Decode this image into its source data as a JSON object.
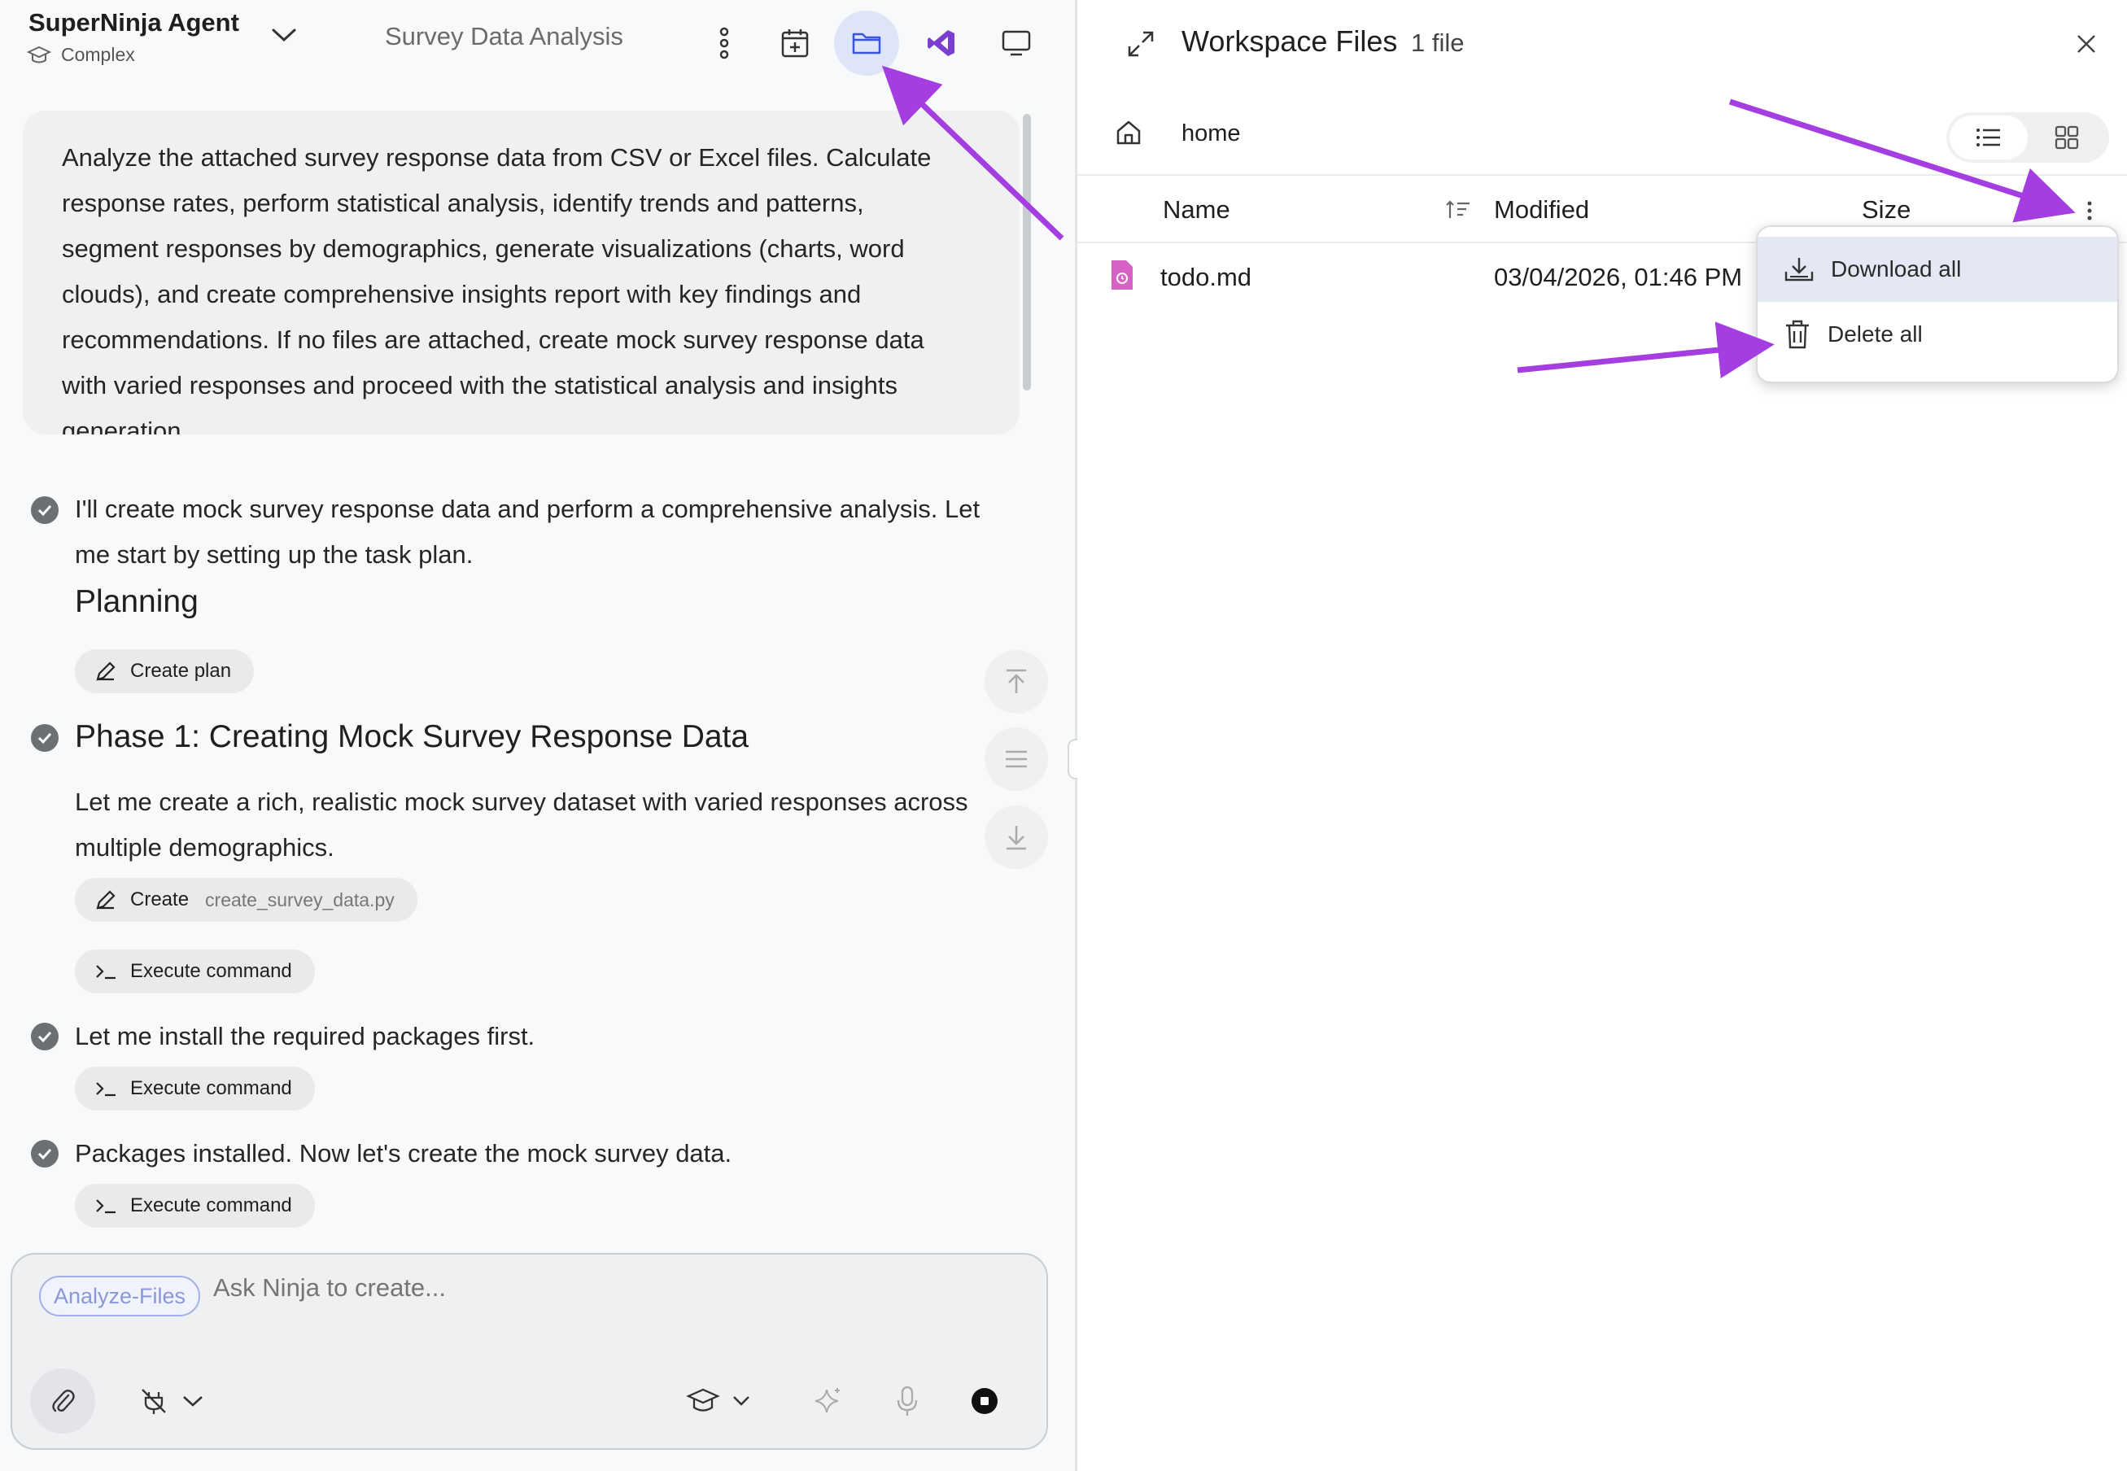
{
  "header": {
    "agent_name": "SuperNinja Agent",
    "agent_mode": "Complex",
    "task_title": "Survey Data Analysis"
  },
  "toolbar": {
    "icons": [
      "more-vertical-icon",
      "calendar-add-icon",
      "folder-icon",
      "vscode-icon",
      "monitor-icon"
    ],
    "active": "folder-icon",
    "active_color": "#dde5f6"
  },
  "prompt": {
    "lines": [
      "Analyze the attached survey response data from CSV or Excel files. Calculate",
      "response rates, perform statistical analysis, identify trends and patterns,",
      "segment responses by demographics, generate visualizations (charts, word",
      "clouds), and create comprehensive insights report with key findings and",
      "recommendations. If no files are attached, create mock survey response data",
      "with varied responses and proceed with the statistical analysis and insights",
      "generation."
    ]
  },
  "steps": {
    "s1_line1": "I'll create mock survey response data and perform a comprehensive analysis. Let",
    "s1_line2": "me start by setting up the task plan.",
    "planning_title": "Planning",
    "create_plan_label": "Create plan",
    "phase1_title": "Phase 1: Creating Mock Survey Response Data",
    "phase1_line1": "Let me create a rich, realistic mock survey dataset with varied responses across",
    "phase1_line2": "multiple demographics.",
    "create_label": "Create",
    "create_file": "create_survey_data.py",
    "execute_label": "Execute command",
    "s3_text": "Let me install the required packages first.",
    "s4_text": "Packages installed. Now let's create the mock survey data."
  },
  "composer": {
    "tag": "Analyze-Files",
    "placeholder": "Ask Ninja to create..."
  },
  "panel": {
    "title": "Workspace Files",
    "count": "1 file",
    "breadcrumb": "home",
    "columns": {
      "name": "Name",
      "modified": "Modified",
      "size": "Size"
    },
    "files": [
      {
        "name": "todo.md",
        "modified": "03/04/2026, 01:46 PM"
      }
    ]
  },
  "menu": {
    "download_all": "Download all",
    "delete_all": "Delete all"
  },
  "colors": {
    "accent": "#3b55d9",
    "annotation_arrow": "#a43ee0",
    "file_icon": "#d663c4"
  }
}
